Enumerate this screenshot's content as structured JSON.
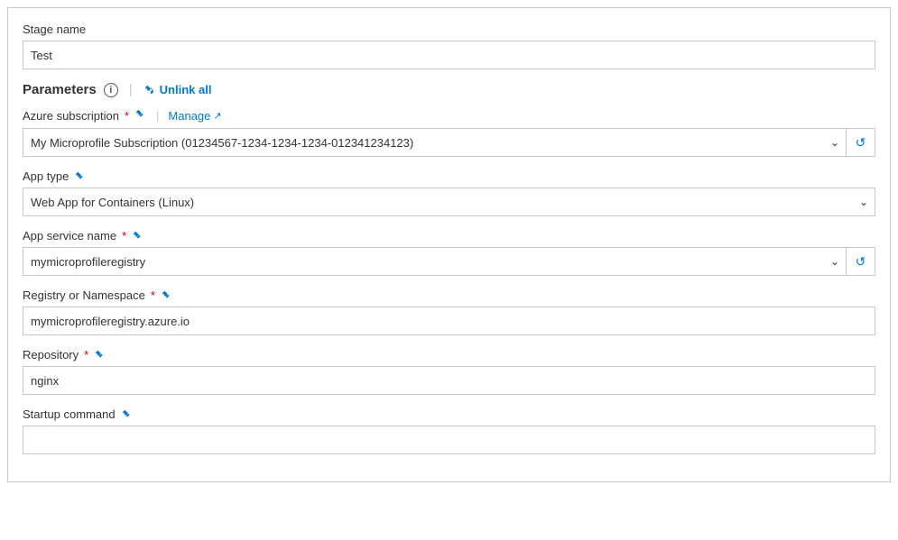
{
  "stage": {
    "label": "Stage name",
    "value": "Test"
  },
  "parameters": {
    "title": "Parameters",
    "separator": "|",
    "unlink_all_label": "Unlink all"
  },
  "azure_subscription": {
    "label": "Azure subscription",
    "required": true,
    "manage_label": "Manage",
    "value": "My Microprofile Subscription (01234567-1234-1234-1234-012341234123)",
    "options": [
      "My Microprofile Subscription (01234567-1234-1234-1234-012341234123)"
    ]
  },
  "app_type": {
    "label": "App type",
    "value": "Web App for Containers (Linux)",
    "options": [
      "Web App for Containers (Linux)"
    ]
  },
  "app_service_name": {
    "label": "App service name",
    "required": true,
    "value": "mymicroprofileregistry",
    "options": [
      "mymicroprofileregistry"
    ]
  },
  "registry_namespace": {
    "label": "Registry or Namespace",
    "required": true,
    "value": "mymicroprofileregistry.azure.io"
  },
  "repository": {
    "label": "Repository",
    "required": true,
    "value": "nginx"
  },
  "startup_command": {
    "label": "Startup command",
    "value": ""
  }
}
